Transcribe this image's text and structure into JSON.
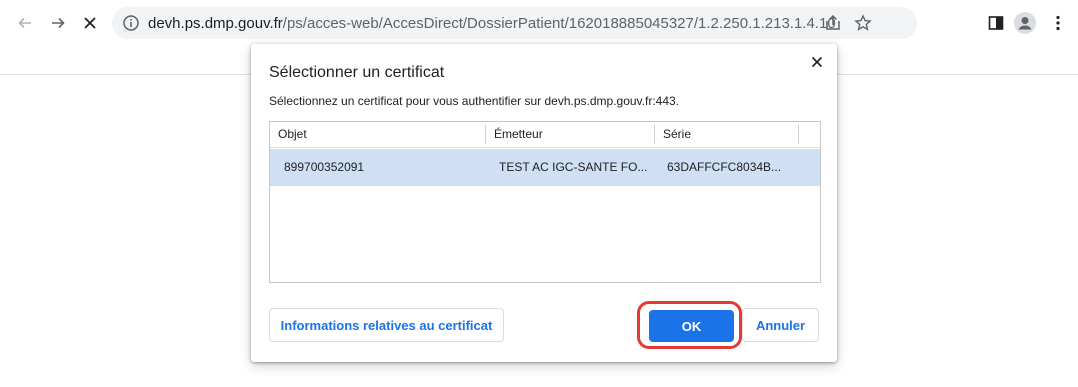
{
  "browser": {
    "url_host": "devh.ps.dmp.gouv.fr",
    "url_path": "/ps/acces-web/AccesDirect/DossierPatient/162018885045327/1.2.250.1.213.1.4.10",
    "icons": [
      "back-arrow-icon",
      "forward-arrow-icon",
      "stop-loading-icon",
      "info-icon",
      "share-icon",
      "bookmark-star-icon",
      "side-panel-icon",
      "profile-avatar-icon",
      "kebab-menu-icon"
    ]
  },
  "dialog": {
    "title": "Sélectionner un certificat",
    "description": "Sélectionnez un certificat pour vous authentifier sur devh.ps.dmp.gouv.fr:443.",
    "columns": [
      "Objet",
      "Émetteur",
      "Série"
    ],
    "rows": [
      {
        "objet": "899700352091",
        "emetteur": "TEST AC IGC-SANTE FO...",
        "serie": "63DAFFCFC8034B..."
      }
    ],
    "info_button": "Informations relatives au certificat",
    "ok_button": "OK",
    "cancel_button": "Annuler"
  },
  "colors": {
    "accent": "#1a73e8",
    "selected_row": "#cfe0f5",
    "highlight": "#e53935"
  }
}
